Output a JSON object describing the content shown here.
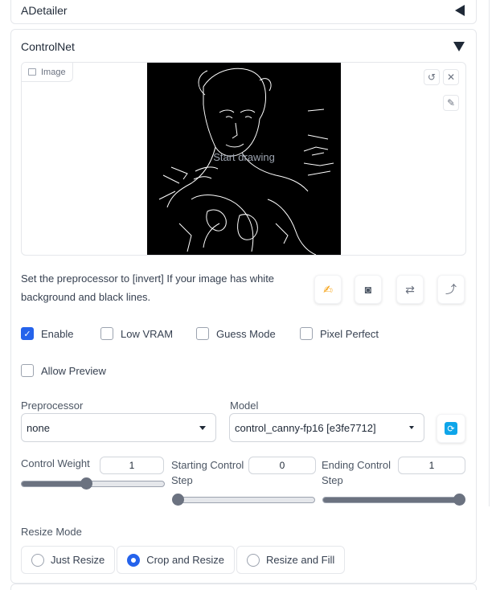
{
  "adetailer": {
    "title": "ADetailer"
  },
  "controlnet": {
    "title": "ControlNet",
    "image_panel": {
      "label": "Image",
      "hint": "Start drawing"
    },
    "hint_text": "Set the preprocessor to [invert] If your image has white background and black lines.",
    "checkboxes": [
      {
        "label": "Enable",
        "checked": true
      },
      {
        "label": "Low VRAM",
        "checked": false
      },
      {
        "label": "Guess Mode",
        "checked": false
      },
      {
        "label": "Pixel Perfect",
        "checked": false
      },
      {
        "label": "Allow Preview",
        "checked": false
      }
    ],
    "preprocessor": {
      "label": "Preprocessor",
      "value": "none"
    },
    "model": {
      "label": "Model",
      "value": "control_canny-fp16 [e3fe7712]"
    },
    "sliders": {
      "weight": {
        "label": "Control Weight",
        "value": "1",
        "level": 0.45
      },
      "start": {
        "label_line1": "Starting Control",
        "label_line2": "Step",
        "value": "0",
        "level": 0.0
      },
      "end": {
        "label_line1": "Ending Control",
        "label_line2": "Step",
        "value": "1",
        "level": 1.0
      }
    },
    "resize_mode": {
      "label": "Resize Mode",
      "options": [
        "Just Resize",
        "Crop and Resize",
        "Resize and Fill"
      ],
      "selected": "Crop and Resize"
    }
  },
  "icons": {
    "tools": [
      "undo-icon",
      "close-icon",
      "brush-icon"
    ],
    "actions": [
      "edit-icon",
      "camera-icon",
      "swap-icon",
      "curve-arrow-icon"
    ],
    "refresh": "refresh-icon",
    "accent": "#2563eb",
    "refresh_color": "#0ea5e9"
  }
}
